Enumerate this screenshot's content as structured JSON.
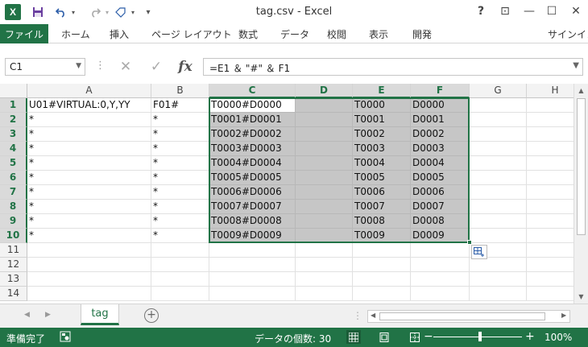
{
  "app": {
    "logo": "X",
    "title": "tag.csv - Excel",
    "sign_in": "サインイン"
  },
  "quick_access": {
    "save_icon": "floppy-icon",
    "undo_icon": "undo-icon",
    "redo_icon": "redo-icon",
    "touch_icon": "touch-mode-icon"
  },
  "window_buttons": {
    "help": "?",
    "restore_ribbon": "⊡",
    "minimize": "—",
    "maximize": "☐",
    "close": "✕"
  },
  "ribbon": {
    "file": "ファイル",
    "tabs": [
      "ホーム",
      "挿入",
      "ページ レイアウト",
      "数式",
      "データ",
      "校閲",
      "表示",
      "開発"
    ]
  },
  "formula_bar": {
    "name_box": "C1",
    "cancel": "✕",
    "enter": "✓",
    "fx": "fx",
    "formula": "=E1 ＆ \"#\" ＆ F1"
  },
  "sheet": {
    "columns": [
      "A",
      "B",
      "C",
      "D",
      "E",
      "F",
      "G",
      "H"
    ],
    "rows": [
      "1",
      "2",
      "3",
      "4",
      "5",
      "6",
      "7",
      "8",
      "9",
      "10",
      "11",
      "12",
      "13",
      "14"
    ],
    "cells": [
      [
        "U01#VIRTUAL:0,Y,YY",
        "F01#",
        "T0000#D0000",
        "",
        "T0000",
        "D0000",
        "",
        ""
      ],
      [
        "*",
        "*",
        "T0001#D0001",
        "",
        "T0001",
        "D0001",
        "",
        ""
      ],
      [
        "*",
        "*",
        "T0002#D0002",
        "",
        "T0002",
        "D0002",
        "",
        ""
      ],
      [
        "*",
        "*",
        "T0003#D0003",
        "",
        "T0003",
        "D0003",
        "",
        ""
      ],
      [
        "*",
        "*",
        "T0004#D0004",
        "",
        "T0004",
        "D0004",
        "",
        ""
      ],
      [
        "*",
        "*",
        "T0005#D0005",
        "",
        "T0005",
        "D0005",
        "",
        ""
      ],
      [
        "*",
        "*",
        "T0006#D0006",
        "",
        "T0006",
        "D0006",
        "",
        ""
      ],
      [
        "*",
        "*",
        "T0007#D0007",
        "",
        "T0007",
        "D0007",
        "",
        ""
      ],
      [
        "*",
        "*",
        "T0008#D0008",
        "",
        "T0008",
        "D0008",
        "",
        ""
      ],
      [
        "*",
        "*",
        "T0009#D0009",
        "",
        "T0009",
        "D0009",
        "",
        ""
      ],
      [
        "",
        "",
        "",
        "",
        "",
        "",
        "",
        ""
      ],
      [
        "",
        "",
        "",
        "",
        "",
        "",
        "",
        ""
      ],
      [
        "",
        "",
        "",
        "",
        "",
        "",
        "",
        ""
      ],
      [
        "",
        "",
        "",
        "",
        "",
        "",
        "",
        ""
      ]
    ],
    "selection": "C1:F10",
    "active_cell": "C1"
  },
  "sheet_tabs": {
    "tabs": [
      "tag"
    ],
    "active": "tag",
    "add": "+"
  },
  "status_bar": {
    "ready": "準備完了",
    "count": "データの個数: 30",
    "zoom_minus": "−",
    "zoom_plus": "+",
    "zoom": "100%"
  },
  "colors": {
    "accent": "#217346",
    "selection_fill": "#c6c6c6"
  }
}
